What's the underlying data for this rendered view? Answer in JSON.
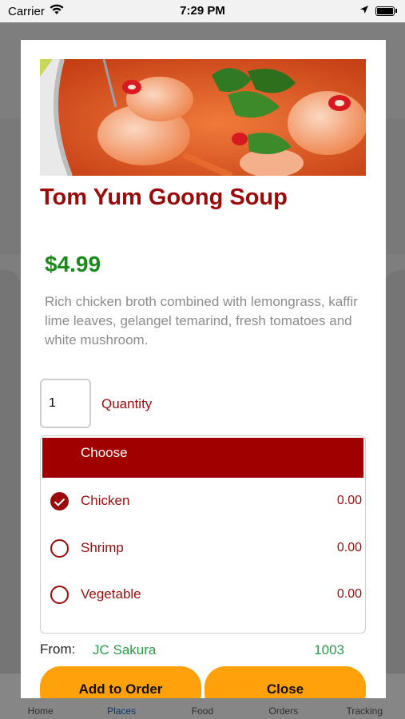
{
  "status_bar": {
    "carrier": "Carrier",
    "time": "7:29 PM",
    "icons": [
      "wifi-icon",
      "location-arrow-icon",
      "battery-icon"
    ]
  },
  "tab_bar": {
    "items": [
      {
        "label": "Home"
      },
      {
        "label": "Places"
      },
      {
        "label": "Food"
      },
      {
        "label": "Orders"
      },
      {
        "label": "Tracking"
      }
    ],
    "active": "Places"
  },
  "modal": {
    "title": "Tom Yum Goong Soup",
    "price": "$4.99",
    "description": "Rich chicken broth combined with lemongrass, kaffir lime leaves, gelangel temarind, fresh tomatoes and white mushroom.",
    "quantity": {
      "value": "1",
      "label": "Quantity"
    },
    "options": {
      "header": "Choose",
      "items": [
        {
          "label": "Chicken",
          "price": "0.00",
          "selected": true
        },
        {
          "label": "Shrimp",
          "price": "0.00",
          "selected": false
        },
        {
          "label": "Vegetable",
          "price": "0.00",
          "selected": false
        }
      ]
    },
    "from": {
      "label": "From:",
      "name": "JC Sakura",
      "code": "1003"
    },
    "buttons": {
      "add": "Add to Order",
      "close": "Close"
    }
  },
  "colors": {
    "brand_red": "#9b0a0a",
    "header_red": "#a00000",
    "price_green": "#1a8a1a",
    "vendor_green": "#2c9a4a",
    "button_orange": "#ffa10a",
    "tab_active": "#1565c0"
  }
}
